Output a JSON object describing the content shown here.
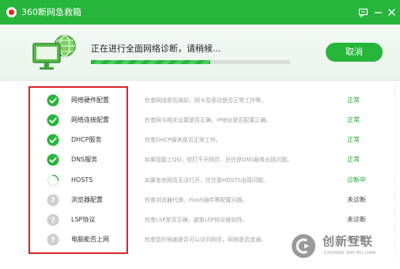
{
  "window": {
    "title": "360断网急救箱"
  },
  "header": {
    "progress_text": "正在进行全面网络诊断，请稍候...",
    "progress_value": 0.6,
    "cancel_label": "取消"
  },
  "items": [
    {
      "name": "网络硬件配置",
      "desc": "检查网线是否插好，网卡及驱动是否正常工作等。",
      "status": "正常",
      "state": "ok"
    },
    {
      "name": "网络连接配置",
      "desc": "检查网卡相关设置是否正确，IP地址是否配置正确。",
      "status": "正常",
      "state": "ok"
    },
    {
      "name": "DHCP服务",
      "desc": "检查DHCP服务是否正常工作。",
      "status": "正常",
      "state": "ok"
    },
    {
      "name": "DNS服务",
      "desc": "如果您能上QQ，但打不开网页，往往是DNS服务出现问题。",
      "status": "正常",
      "state": "ok"
    },
    {
      "name": "HOSTS",
      "desc": "如果有些网页无法打开，往往是HOSTS出现问题。",
      "status": "诊断中",
      "state": "checking"
    },
    {
      "name": "浏览器配置",
      "desc": "检查浏览器代理、Flash插件等配置问题。",
      "status": "未诊断",
      "state": "pending"
    },
    {
      "name": "LSP协议",
      "desc": "检查LSP是否正确，避免LSP协议被劫持。",
      "status": "未诊断",
      "state": "pending"
    },
    {
      "name": "电脑能否上网",
      "desc": "检查您的电脑是否可以访问网页，网络是否连通。",
      "status": "未诊断",
      "state": "pending"
    }
  ],
  "colors": {
    "brand_green": "#27b53c",
    "status_ok": "#2aa43a",
    "status_checking": "#2aa43a",
    "status_pending": "#444444",
    "highlight_red": "#d8262c"
  },
  "icons": {
    "ok": "check-circle-icon",
    "checking": "spinner-icon",
    "pending": "question-circle-icon"
  },
  "watermark": {
    "title": "创新互联",
    "subtitle": "CHUANG XIN HU LIAN"
  }
}
